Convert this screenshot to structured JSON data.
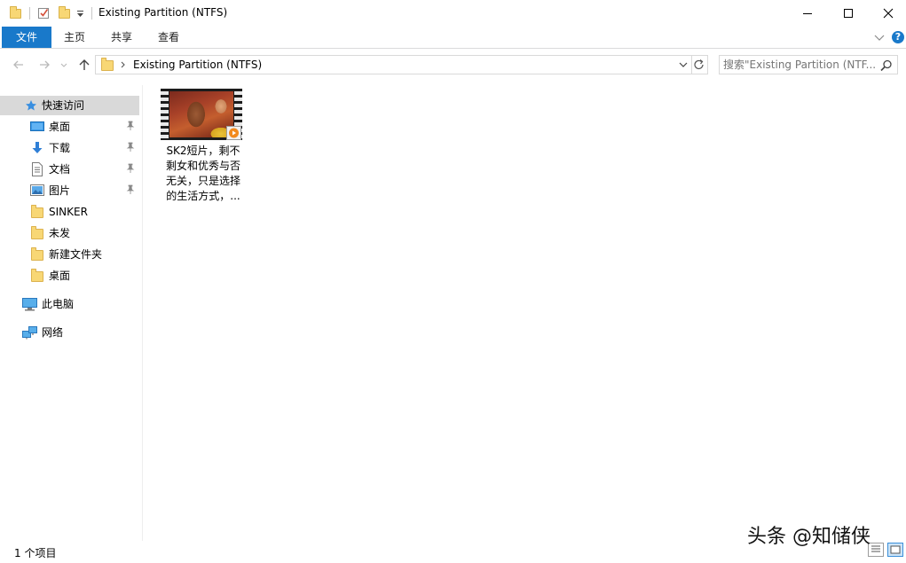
{
  "window": {
    "title": "Existing Partition (NTFS)"
  },
  "ribbon": {
    "tabs": [
      "文件",
      "主页",
      "共享",
      "查看"
    ]
  },
  "address": {
    "path": "Existing Partition (NTFS)"
  },
  "search": {
    "placeholder": "搜索\"Existing Partition (NTF..."
  },
  "navigation": {
    "quick_access": "快速访问",
    "items": [
      {
        "label": "桌面",
        "icon": "desktop-icon",
        "pinned": true
      },
      {
        "label": "下载",
        "icon": "download-arrow-icon",
        "pinned": true
      },
      {
        "label": "文档",
        "icon": "document-icon",
        "pinned": true
      },
      {
        "label": "图片",
        "icon": "picture-icon",
        "pinned": true
      },
      {
        "label": "SINKER",
        "icon": "folder-icon",
        "pinned": false
      },
      {
        "label": "未发",
        "icon": "folder-icon",
        "pinned": false
      },
      {
        "label": "新建文件夹",
        "icon": "folder-icon",
        "pinned": false
      },
      {
        "label": "桌面",
        "icon": "folder-icon",
        "pinned": false
      }
    ],
    "this_pc": "此电脑",
    "network": "网络"
  },
  "files": [
    {
      "name": "SK2短片，剩不剩女和优秀与否无关，只是选择的生活方式，...",
      "lines": [
        "SK2短片，剩不",
        "剩女和优秀与否",
        "无关，只是选择",
        "的生活方式，..."
      ],
      "type": "video"
    }
  ],
  "status": {
    "count_text": "1 个项目"
  },
  "watermark": {
    "text": "头条 @知储侠"
  },
  "colors": {
    "file_tab": "#1979ca",
    "selected_nav": "#d9d9d9",
    "folder": "#f8d775",
    "help": "#1979ca"
  }
}
